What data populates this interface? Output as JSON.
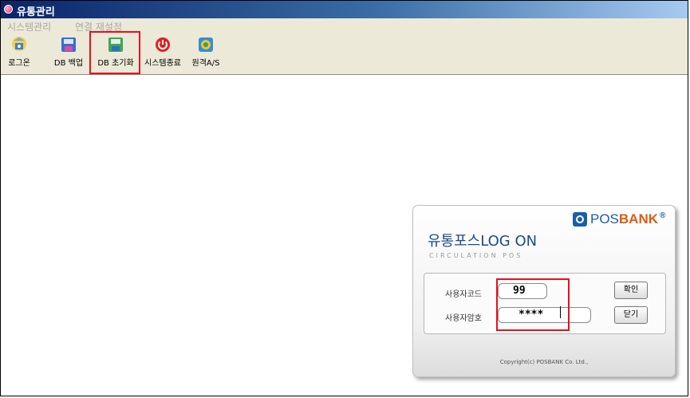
{
  "window": {
    "title": "유통관리"
  },
  "menu": {
    "items": [
      "시스템관리",
      "연결 재설정"
    ]
  },
  "toolbar": {
    "buttons": [
      {
        "label": "로그온",
        "icon": "logon-icon"
      },
      {
        "label": "DB 백업",
        "icon": "db-backup-icon"
      },
      {
        "label": "DB 초기화",
        "icon": "db-reset-icon"
      },
      {
        "label": "시스템종료",
        "icon": "power-icon"
      },
      {
        "label": "원격A/S",
        "icon": "remote-support-icon"
      }
    ]
  },
  "dialog": {
    "brand": {
      "pos": "POS",
      "bank": "BANK",
      "reg": "®"
    },
    "title": "유통포스LOG ON",
    "subtitle": "CIRCULATION POS",
    "user_code_label": "사용자코드",
    "user_code_value": "99",
    "password_label": "사용자암호",
    "password_value": "****",
    "confirm_label": "확인",
    "close_label": "닫기",
    "copyright": "Copyright(c) POSBANK Co. Ltd.,"
  },
  "colors": {
    "brand_blue": "#1a5ea8",
    "brand_orange": "#e05a12",
    "highlight_red": "#e8101c"
  }
}
